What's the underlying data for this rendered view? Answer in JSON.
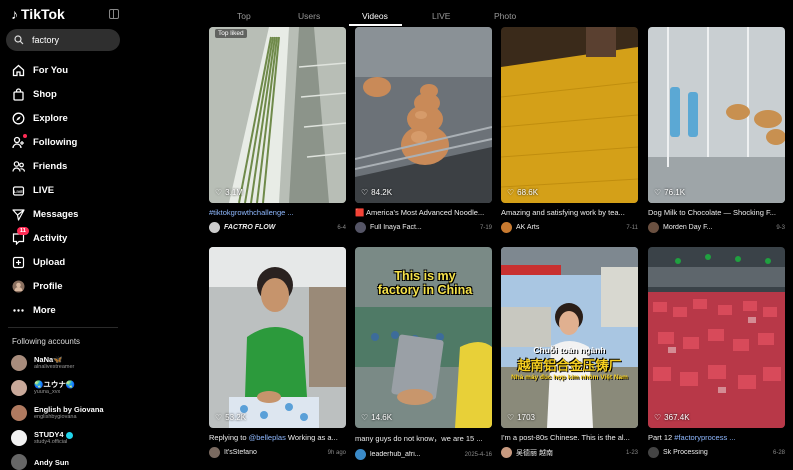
{
  "app": {
    "title": "TikTok"
  },
  "search": {
    "value": "factory"
  },
  "nav": [
    {
      "label": "For You",
      "icon": "home-icon"
    },
    {
      "label": "Shop",
      "icon": "shop-icon"
    },
    {
      "label": "Explore",
      "icon": "compass-icon"
    },
    {
      "label": "Following",
      "icon": "following-icon"
    },
    {
      "label": "Friends",
      "icon": "friends-icon"
    },
    {
      "label": "LIVE",
      "icon": "live-icon"
    },
    {
      "label": "Messages",
      "icon": "send-icon"
    },
    {
      "label": "Activity",
      "icon": "inbox-icon",
      "badge": "11"
    },
    {
      "label": "Upload",
      "icon": "plus-icon"
    },
    {
      "label": "Profile",
      "icon": "avatar-icon"
    },
    {
      "label": "More",
      "icon": "more-icon"
    }
  ],
  "following": {
    "title": "Following accounts",
    "accounts": [
      {
        "name": "NaNa🦋",
        "username": "alnalivestreamer"
      },
      {
        "name": "🌏ユウナ🌏",
        "username": "yuuna_xvx"
      },
      {
        "name": "English by Giovana",
        "username": "englishbygiovana"
      },
      {
        "name": "STUDY4",
        "username": "study4.official"
      },
      {
        "name": "Andy Sun",
        "username": ""
      }
    ]
  },
  "tabs": [
    "Top",
    "Users",
    "Videos",
    "LIVE",
    "Photo"
  ],
  "active_tab": "Videos",
  "videos": [
    {
      "likes": "3.1M",
      "top_liked": "Top liked",
      "caption_tag": "#tiktokgrowthchallenge ...",
      "caption": "",
      "author": "FACTRO FLOW",
      "date": "6-4"
    },
    {
      "likes": "84.2K",
      "caption": "🟥 America's Most Advanced Noodle...",
      "author": "Full Inaya Fact...",
      "date": "7-19"
    },
    {
      "likes": "68.6K",
      "caption": "Amazing and satisfying work by tea...",
      "author": "AK Arts",
      "date": "7-11"
    },
    {
      "likes": "76.1K",
      "caption": "Dog Milk to Chocolate — Shocking F...",
      "author": "Morden Day F...",
      "date": "9-3"
    },
    {
      "likes": "53.2K",
      "caption": "Replying to ",
      "caption_tag": "@belleplas",
      "caption_after": " Working as a...",
      "author": "It'sStefano",
      "date": "9h ago"
    },
    {
      "likes": "14.6K",
      "overlay": "This is my factory in China",
      "caption": "many guys do not know，we are 15 ...",
      "author": "leaderhub_afri...",
      "date": "2025-4-16"
    },
    {
      "likes": "1703",
      "overlay_vn": "Chuỗi toàn ngành",
      "overlay_cn": "越南铝合金压铸厂",
      "overlay_vn2": "Nhà máy đúc hợp kim nhôm Việt Nam",
      "caption": "I'm a post-80s Chinese. This is the al...",
      "author": "吴德丽 越南",
      "date": "1-23"
    },
    {
      "likes": "367.4K",
      "caption": "Part 12 ",
      "caption_tag": "#factoryprocess ...",
      "author": "Sk Processing",
      "date": "6-28"
    }
  ]
}
